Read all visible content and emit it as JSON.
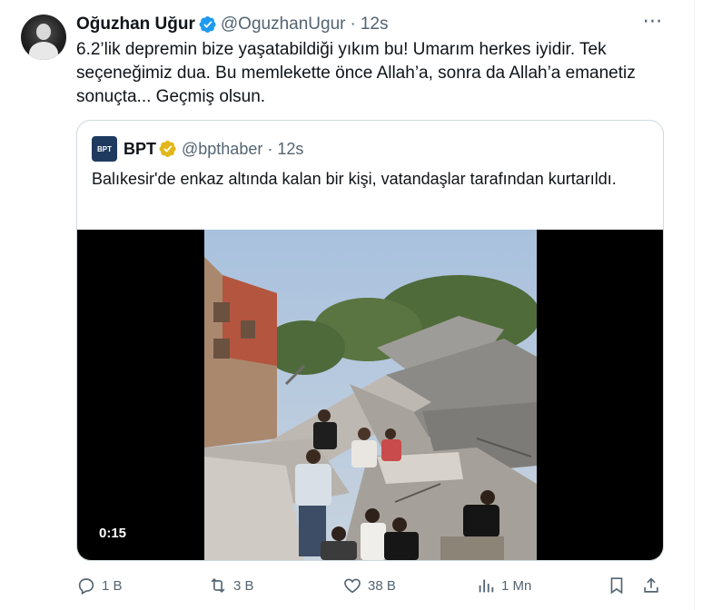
{
  "tweet": {
    "author_name": "Oğuzhan Uğur",
    "handle": "@OguzhanUgur",
    "separator": "·",
    "time": "12s",
    "text": "6.2’lik depremin bize yaşatabildiği yıkım bu! Umarım herkes iyidir. Tek seçeneğimiz dua. Bu memlekette önce Allah’a, sonra da Allah’a emanetiz sonuçta... Geçmiş olsun.",
    "more_icon": "more-horizontal-icon"
  },
  "quoted": {
    "avatar_text": "BPT",
    "author_name": "BPT",
    "handle": "@bpthaber",
    "separator": "·",
    "time": "12s",
    "text": "Balıkesir'de enkaz altında kalan bir kişi, vatandaşlar tarafından kurtarıldı.",
    "video_duration": "0:15"
  },
  "actions": {
    "reply_count": "1 B",
    "retweet_count": "3 B",
    "like_count": "38 B",
    "views_count": "1 Mn"
  },
  "colors": {
    "verified_blue": "#1d9bf0",
    "verified_gold": "#e2b719",
    "muted_text": "#536471",
    "border": "#cfd9de"
  }
}
